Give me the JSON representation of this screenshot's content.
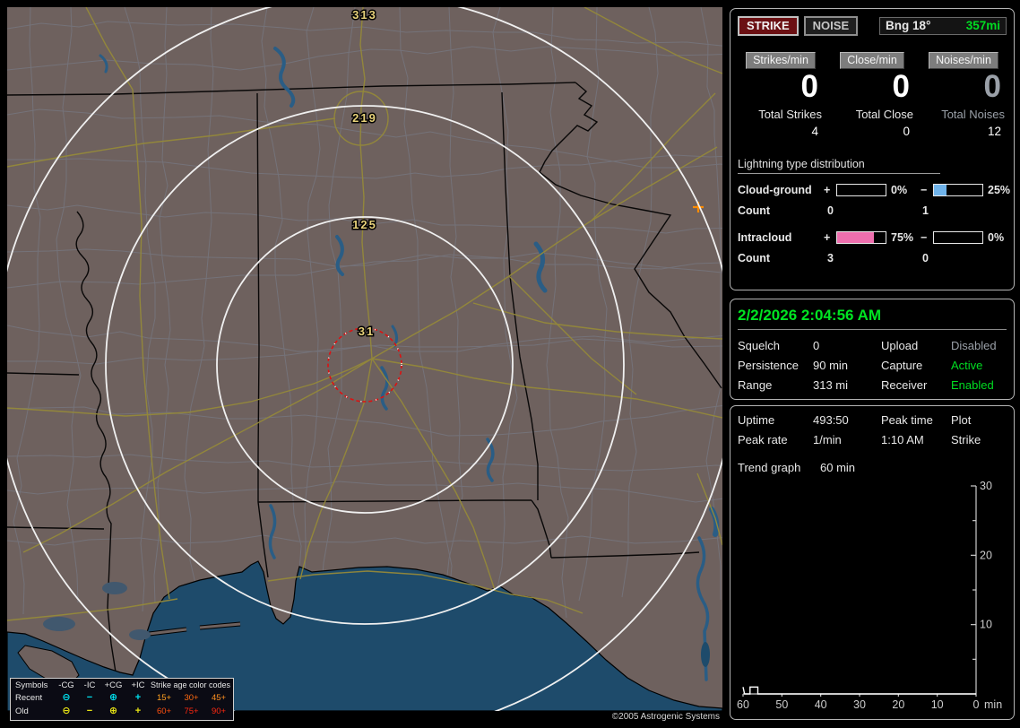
{
  "topbar": {
    "strike": "STRIKE",
    "noise": "NOISE",
    "bearing": "Bng 18°",
    "distance": "357mi"
  },
  "counters": [
    {
      "rate_label": "Strikes/min",
      "rate": "0",
      "total_label": "Total Strikes",
      "total": "4",
      "dim": false
    },
    {
      "rate_label": "Close/min",
      "rate": "0",
      "total_label": "Total Close",
      "total": "0",
      "dim": false
    },
    {
      "rate_label": "Noises/min",
      "rate": "0",
      "total_label": "Total Noises",
      "total": "12",
      "dim": true
    }
  ],
  "distribution": {
    "title": "Lightning type distribution",
    "count_label": "Count",
    "rows": [
      {
        "label": "Cloud-ground",
        "plus_sign": "+",
        "plus_pct": 0,
        "plus_pct_text": "0%",
        "plus_fill": "#ee6fae",
        "minus_sign": "−",
        "minus_pct": 25,
        "minus_pct_text": "25%",
        "minus_fill": "#6fb3ea",
        "plus_count": "0",
        "minus_count": "1"
      },
      {
        "label": "Intracloud",
        "plus_sign": "+",
        "plus_pct": 75,
        "plus_pct_text": "75%",
        "plus_fill": "#ee6fae",
        "minus_sign": "−",
        "minus_pct": 0,
        "minus_pct_text": "0%",
        "minus_fill": "#6fb3ea",
        "plus_count": "3",
        "minus_count": "0"
      }
    ]
  },
  "status": {
    "datetime": "2/2/2026 2:04:56 AM",
    "rows": [
      {
        "l1": "Squelch",
        "v1": "0",
        "l2": "Upload",
        "v2": "Disabled",
        "v2_state": "dim"
      },
      {
        "l1": "Persistence",
        "v1": "90 min",
        "l2": "Capture",
        "v2": "Active",
        "v2_state": "green"
      },
      {
        "l1": "Range",
        "v1": "313 mi",
        "l2": "Receiver",
        "v2": "Enabled",
        "v2_state": "green"
      }
    ]
  },
  "stats": {
    "rows": [
      {
        "l1": "Uptime",
        "v1": "493:50",
        "l2": "Peak time",
        "v2": "Plot"
      },
      {
        "l1": "Peak rate",
        "v1": "1/min",
        "l2": "1:10 AM",
        "v2": "Strike"
      }
    ],
    "trend_label": "Trend graph",
    "trend_value": "60 min"
  },
  "chart_data": {
    "type": "line",
    "title": "",
    "xlabel": "min",
    "x_unit_label": "min",
    "xlim": [
      60,
      0
    ],
    "ylim": [
      0,
      30
    ],
    "x_ticks": [
      60,
      50,
      40,
      30,
      20,
      10,
      0
    ],
    "y_ticks": [
      30,
      20,
      10
    ],
    "y_minor_ticks": [
      25,
      15,
      5
    ],
    "series": [
      {
        "name": "Strikes/min",
        "points": [
          [
            60,
            1
          ],
          [
            59.6,
            0
          ],
          [
            58.2,
            0
          ],
          [
            58.2,
            1
          ],
          [
            56.2,
            1
          ],
          [
            56.2,
            0
          ],
          [
            0,
            0
          ]
        ]
      }
    ],
    "line_color": "#ffffff",
    "axis_color": "#cccccc",
    "grid": false,
    "legend_position": "none"
  },
  "map": {
    "ring_labels": [
      {
        "text": "313"
      },
      {
        "text": "219"
      },
      {
        "text": "125"
      },
      {
        "text": "31"
      }
    ],
    "copyright": "©2005 Astrogenic Systems",
    "colors": {
      "land": "#6e615e",
      "water": "#1e4b6b",
      "road": "#94893a",
      "county": "#7b8494",
      "ring": "#f0f0f0",
      "near_ring": "#dd1111",
      "label": "#e8d27a",
      "strike_marker": "#ff8c00"
    }
  },
  "legend": {
    "header_symbols": "Symbols",
    "header_cols": [
      "-CG",
      "-IC",
      "+CG",
      "+IC"
    ],
    "header_age": "Strike age color codes",
    "rows": [
      {
        "label": "Recent",
        "color": "#00e0ee",
        "symbols": [
          "⊖",
          "−",
          "⊕",
          "+"
        ],
        "ages": [
          {
            "text": "15+",
            "color": "#ffa020"
          },
          {
            "text": "30+",
            "color": "#ff6a10"
          },
          {
            "text": "45+",
            "color": "#ff9020"
          }
        ]
      },
      {
        "label": "Old",
        "color": "#e8e414",
        "symbols": [
          "⊖",
          "−",
          "⊕",
          "+"
        ],
        "ages": [
          {
            "text": "60+",
            "color": "#ff5010"
          },
          {
            "text": "75+",
            "color": "#ff2810"
          },
          {
            "text": "90+",
            "color": "#ff2810"
          }
        ]
      }
    ]
  }
}
